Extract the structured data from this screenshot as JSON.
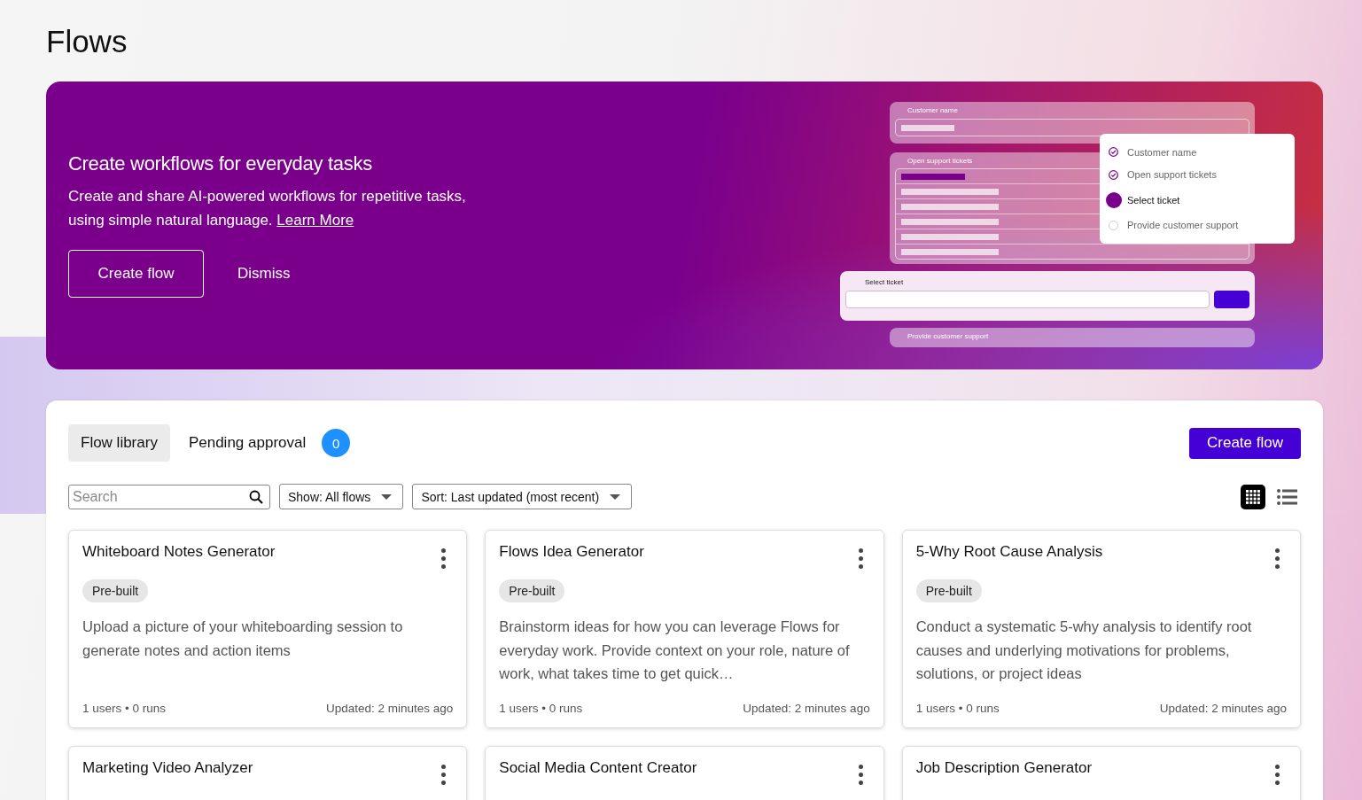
{
  "page": {
    "title": "Flows"
  },
  "banner": {
    "heading": "Create workflows for everyday tasks",
    "text": "Create and share AI-powered workflows for repetitive tasks, using simple natural language.",
    "link": "Learn More",
    "primary_button": "Create flow",
    "secondary_button": "Dismiss",
    "illustration": {
      "field_label": "Customer name",
      "table_label": "Open support tickets",
      "input_label": "Select ticket",
      "footer_label": "Provide customer support",
      "steps": [
        {
          "label": "Customer name",
          "kind": "done"
        },
        {
          "label": "Open support tickets",
          "kind": "done"
        },
        {
          "label": "Select ticket",
          "kind": "current"
        },
        {
          "label": "Provide customer support",
          "kind": "todo"
        }
      ]
    }
  },
  "library": {
    "tabs": [
      {
        "label": "Flow library",
        "selected": true
      },
      {
        "label": "Pending approval",
        "selected": false,
        "count": "0"
      }
    ],
    "create_button": "Create flow",
    "search": {
      "placeholder": "Search"
    },
    "filters": [
      "Show: All flows",
      "Sort: Last updated (most recent)"
    ],
    "views": [
      {
        "kind": "grid",
        "selected": true
      },
      {
        "kind": "list",
        "selected": false
      }
    ],
    "cards": [
      {
        "title": "Whiteboard Notes Generator",
        "badge": "Pre-built",
        "description": "Upload a picture of your whiteboarding session to generate notes and action items",
        "stats": "1 users • 0 runs",
        "updated": "Updated: 2 minutes ago"
      },
      {
        "title": "Flows Idea Generator",
        "badge": "Pre-built",
        "description": "Brainstorm ideas for how you can leverage Flows for everyday work. Provide context on your role, nature of work, what takes time to get quick…",
        "stats": "1 users • 0 runs",
        "updated": "Updated: 2 minutes ago"
      },
      {
        "title": "5-Why Root Cause Analysis",
        "badge": "Pre-built",
        "description": "Conduct a systematic 5-why analysis to identify root causes and underlying motivations for problems, solutions, or project ideas",
        "stats": "1 users • 0 runs",
        "updated": "Updated: 2 minutes ago"
      },
      {
        "title": "Marketing Video Analyzer"
      },
      {
        "title": "Social Media Content Creator"
      },
      {
        "title": "Job Description Generator"
      }
    ]
  }
}
